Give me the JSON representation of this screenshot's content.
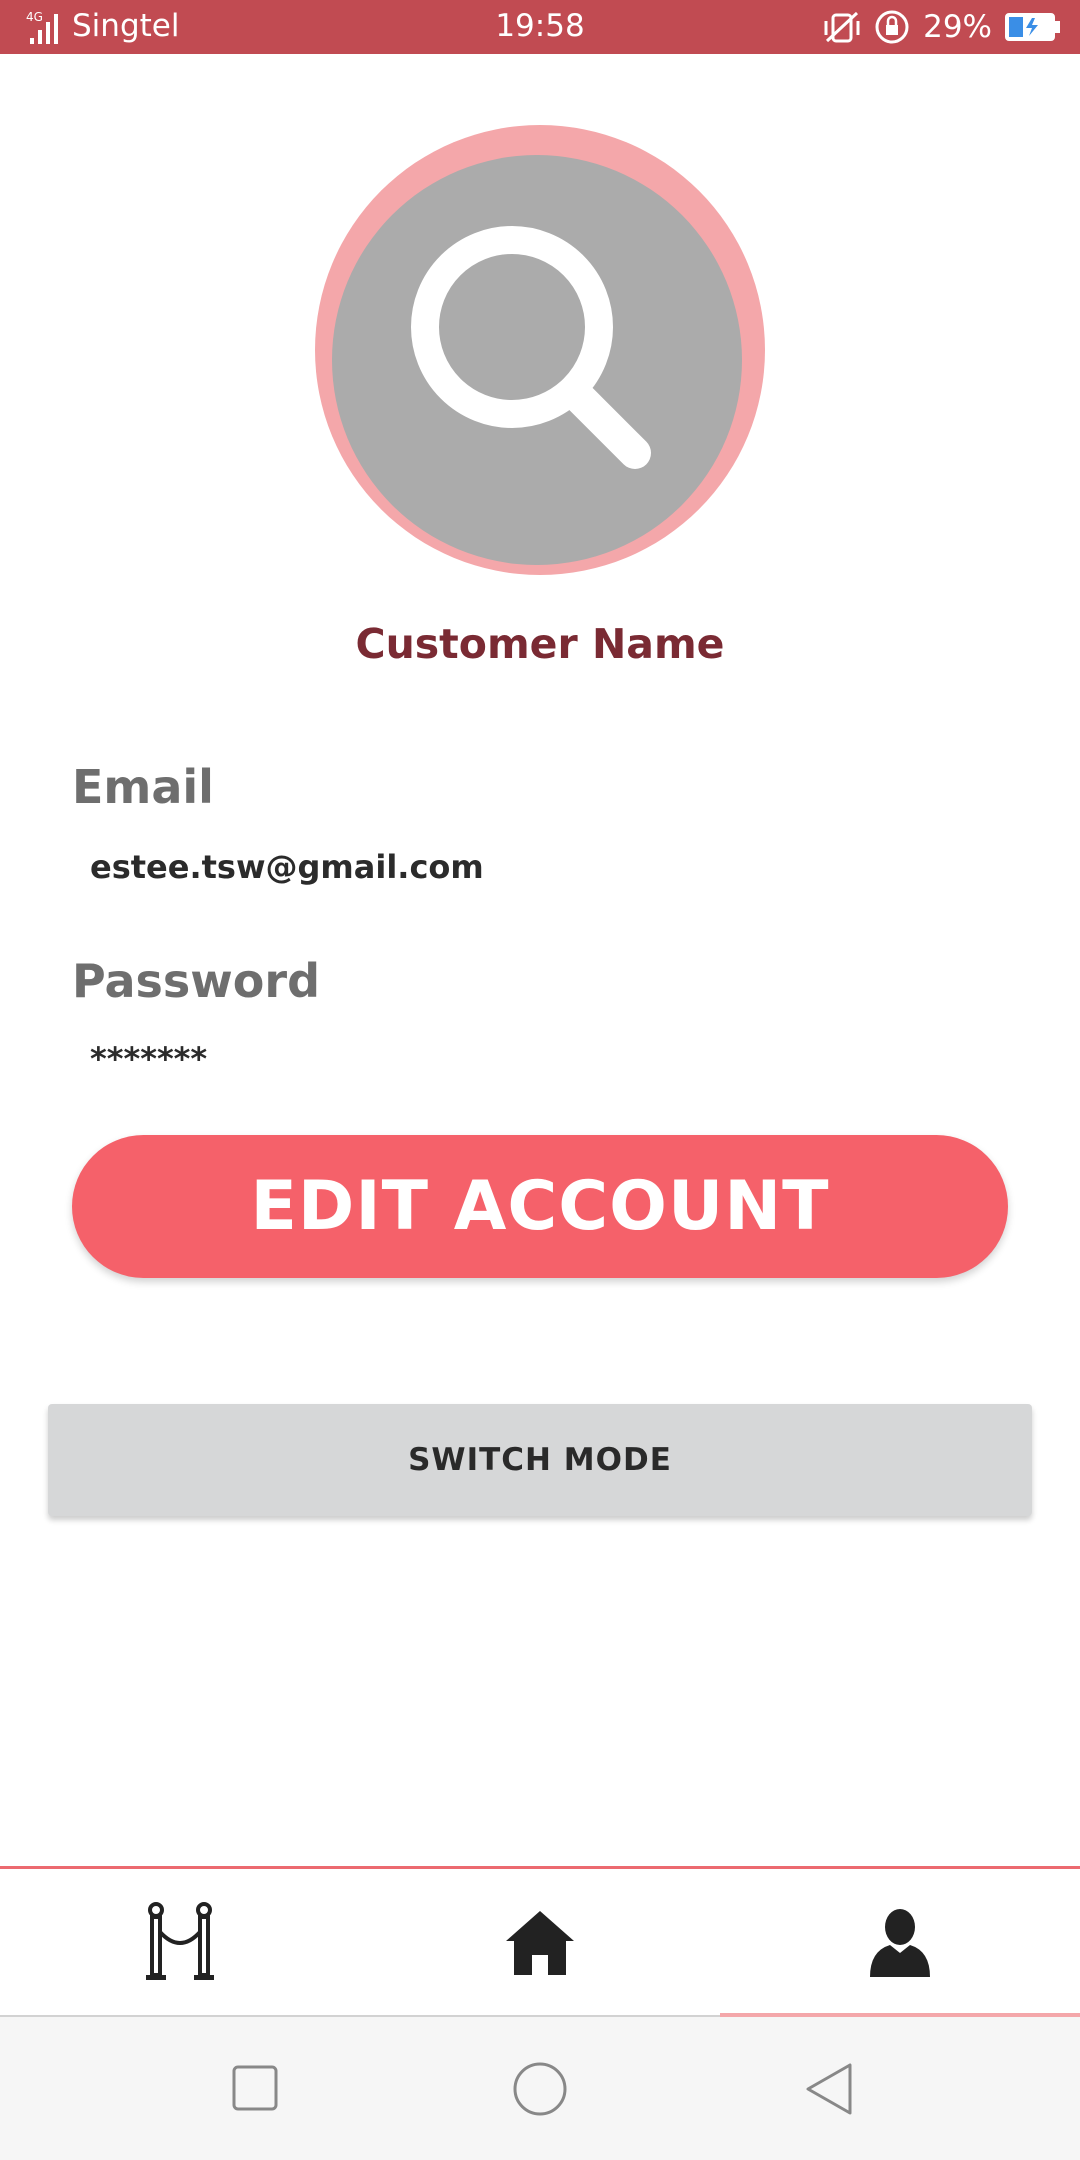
{
  "status_bar": {
    "network": "4G",
    "carrier": "Singtel",
    "time": "19:58",
    "battery": "29%"
  },
  "profile": {
    "name": "Customer Name",
    "email_label": "Email",
    "email_value": "estee.tsw@gmail.com",
    "password_label": "Password",
    "password_value": "*******"
  },
  "actions": {
    "edit_label": "EDIT ACCOUNT",
    "switch_label": "SWITCH MODE"
  },
  "bottom_nav": {
    "items": [
      {
        "icon": "stanchion-icon"
      },
      {
        "icon": "home-icon"
      },
      {
        "icon": "person-icon"
      }
    ],
    "active_index": 2
  },
  "system_nav": {
    "items": [
      "recents-square",
      "home-circle",
      "back-triangle"
    ]
  },
  "colors": {
    "status_bar": "#c14b52",
    "accent": "#f5616a",
    "avatar_ring": "#f4a7aa",
    "name": "#7a2a33"
  }
}
